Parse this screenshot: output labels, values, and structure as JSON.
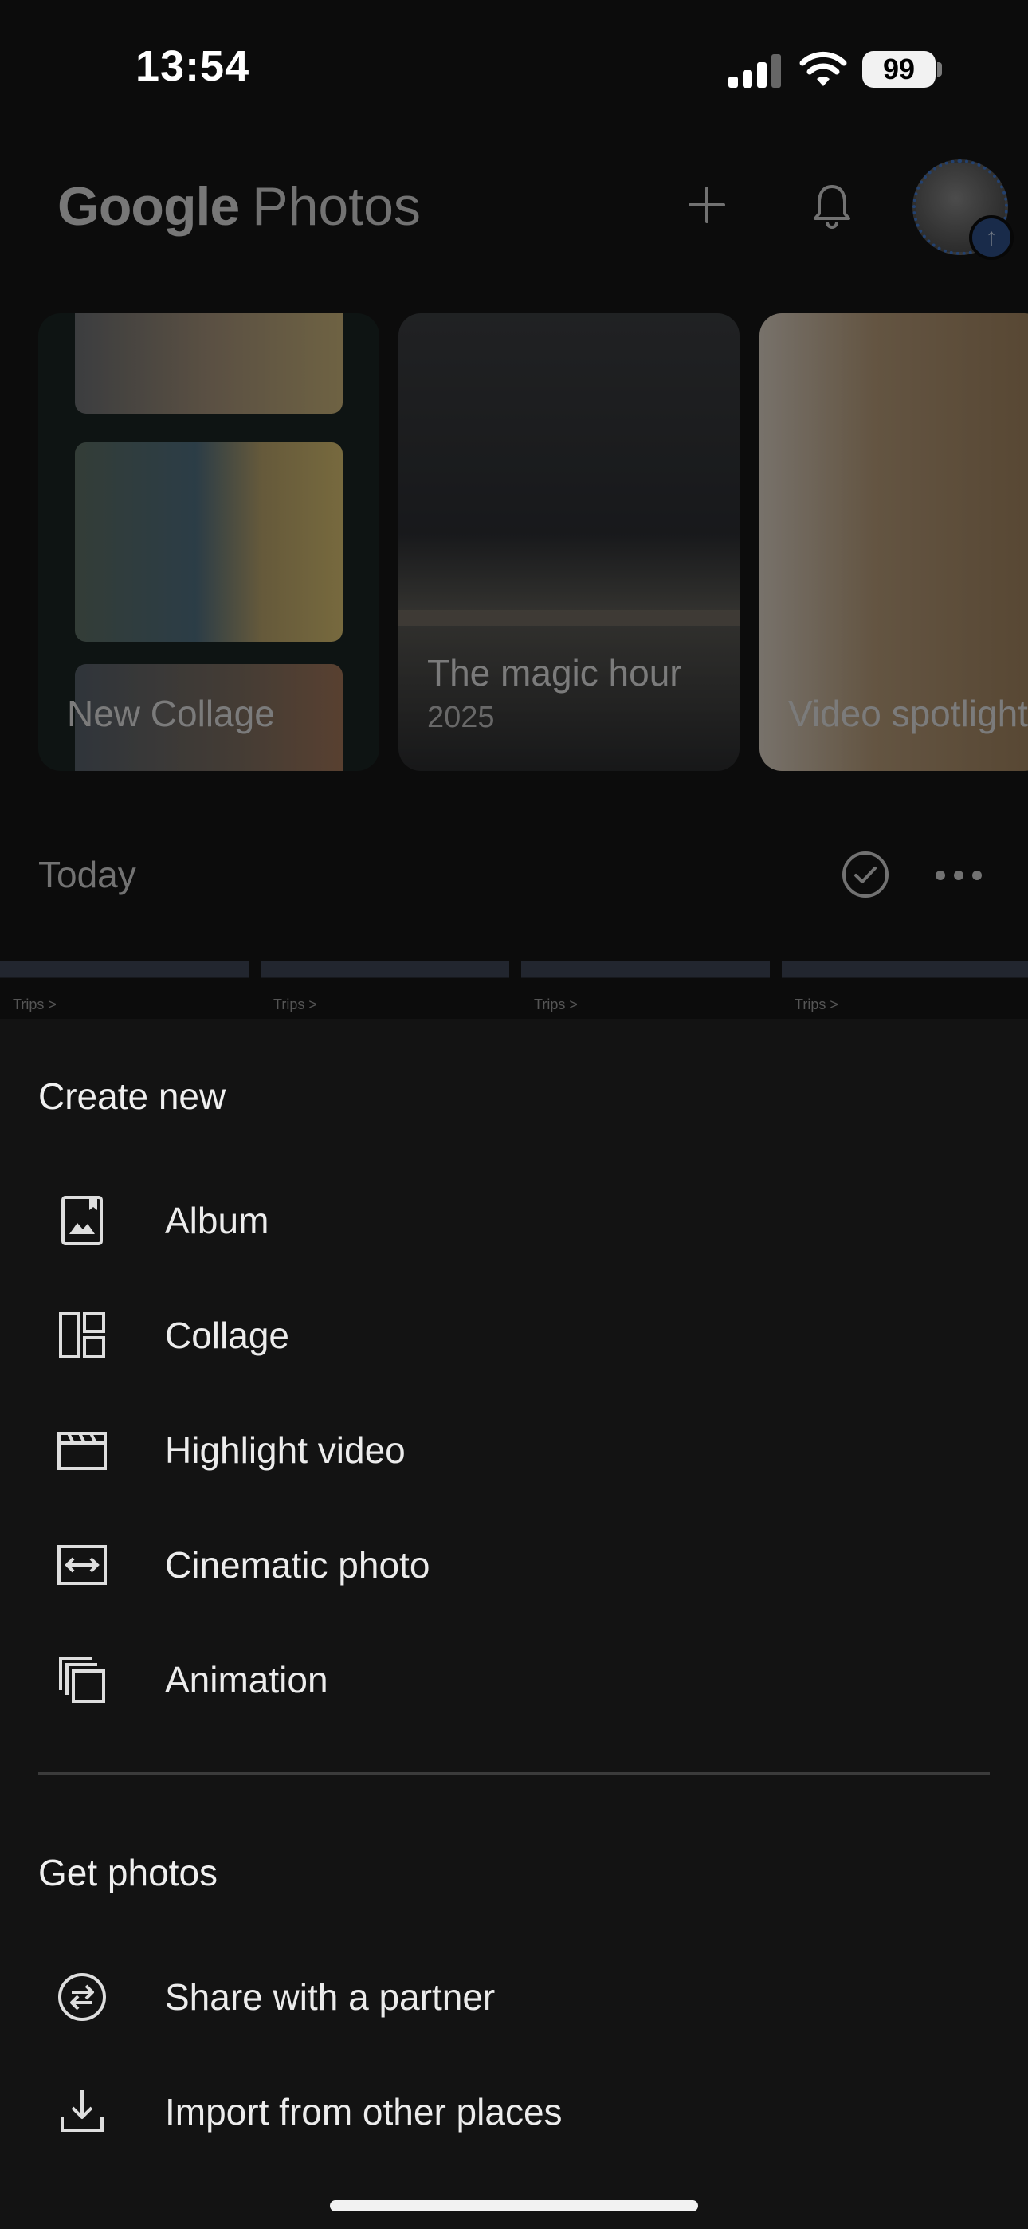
{
  "status_bar": {
    "time": "13:54",
    "battery": "99"
  },
  "header": {
    "logo_google": "Google",
    "logo_photos": "Photos"
  },
  "memories": [
    {
      "title": "New Collage",
      "subtitle": ""
    },
    {
      "title": "The magic hour",
      "subtitle": "2025"
    },
    {
      "title": "Video spotlight",
      "subtitle": ""
    }
  ],
  "today": {
    "label": "Today"
  },
  "thumbnails": [
    "Trips >",
    "Trips >",
    "Trips >",
    "Trips >"
  ],
  "create_new": {
    "title": "Create new",
    "items": [
      {
        "label": "Album",
        "icon": "album-icon"
      },
      {
        "label": "Collage",
        "icon": "collage-icon"
      },
      {
        "label": "Highlight video",
        "icon": "highlight-video-icon"
      },
      {
        "label": "Cinematic photo",
        "icon": "cinematic-photo-icon"
      },
      {
        "label": "Animation",
        "icon": "animation-icon"
      }
    ]
  },
  "get_photos": {
    "title": "Get photos",
    "items": [
      {
        "label": "Share with a partner",
        "icon": "partner-share-icon"
      },
      {
        "label": "Import from other places",
        "icon": "import-icon"
      }
    ]
  }
}
